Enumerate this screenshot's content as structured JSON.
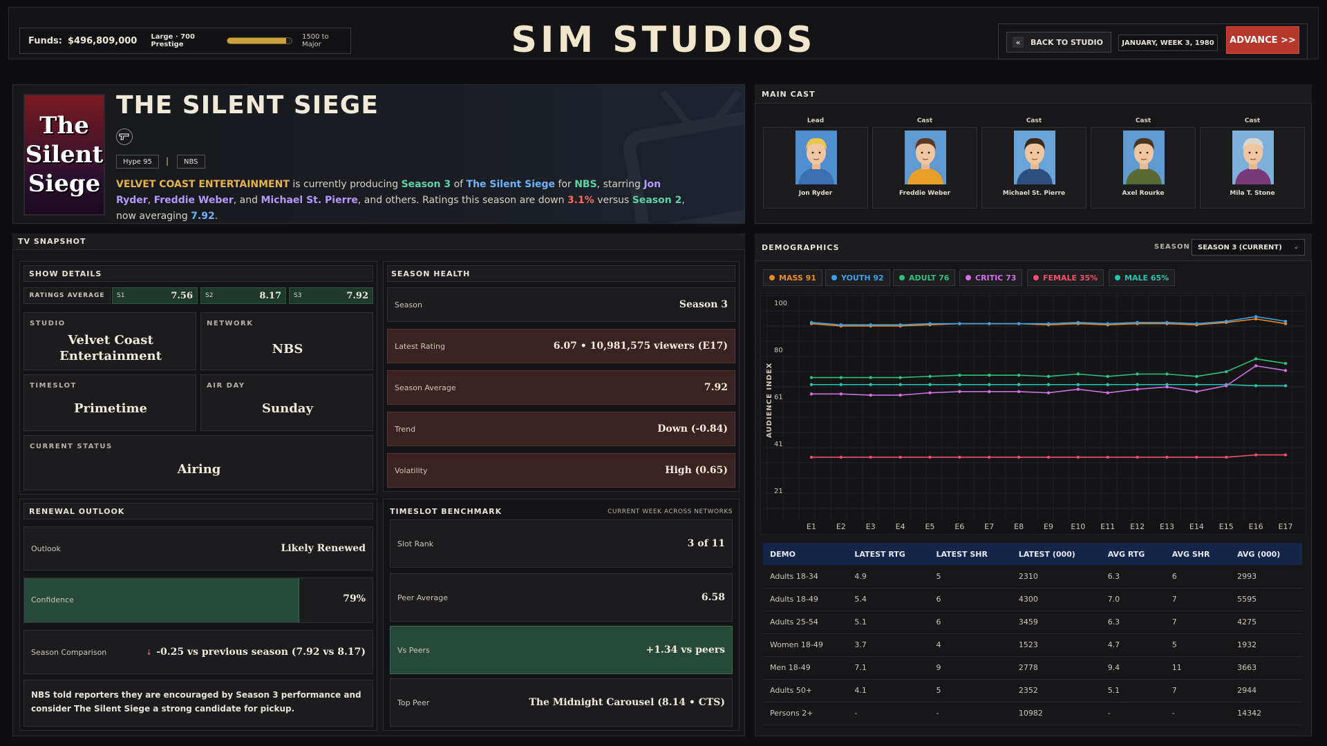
{
  "topbar": {
    "funds_label": "Funds:",
    "funds_value": "$496,809,000",
    "studio_tier": "Large · 700 Prestige",
    "prestige_progress": 0.92,
    "next_tier": "1500 to Major",
    "game_title": "SIM STUDIOS",
    "back_label": "BACK TO STUDIO",
    "back_icon": "«",
    "date": "JANUARY, WEEK 3, 1980",
    "advance_label": "ADVANCE >>"
  },
  "show": {
    "poster_text": [
      "The",
      "Silent",
      "Siege"
    ],
    "title": "THE SILENT SIEGE",
    "genre_icon": "gun-icon",
    "tags": [
      "Hype 95",
      "NBS"
    ],
    "tag_sep": "|",
    "summary": {
      "studio": "VELVET COAST ENTERTAINMENT",
      "t1": " is currently producing ",
      "season": "Season 3",
      "t2": " of ",
      "title": "The Silent Siege",
      "t3": " for ",
      "network": "NBS",
      "t4": ", starring ",
      "star1": "Jon Ryder",
      "t5": ", ",
      "star2": "Freddie Weber",
      "t6": ", and ",
      "star3": "Michael St. Pierre",
      "t7": ", and others. Ratings this season are down ",
      "pct": "3.1%",
      "t8": " versus ",
      "prev": "Season 2",
      "t9": ", now averaging ",
      "avg": "7.92",
      "t10": "."
    }
  },
  "cast": {
    "title": "MAIN CAST",
    "members": [
      {
        "role": "Lead",
        "name": "Jon Ryder",
        "hair": "#e8c74a",
        "shirt": "#3a6fb0",
        "bg": "#4f8fcf"
      },
      {
        "role": "Cast",
        "name": "Freddie Weber",
        "hair": "#5a3a22",
        "shirt": "#e9a02a",
        "bg": "#5f9ad0"
      },
      {
        "role": "Cast",
        "name": "Michael St. Pierre",
        "hair": "#3a2a1e",
        "shirt": "#2c4f80",
        "bg": "#6aa4d6"
      },
      {
        "role": "Cast",
        "name": "Axel Rourke",
        "hair": "#4a3422",
        "shirt": "#5b6a35",
        "bg": "#5f9ad0"
      },
      {
        "role": "Cast",
        "name": "Mila T. Stone",
        "hair": "#d9d6d0",
        "shirt": "#7a3a7a",
        "bg": "#7fb0dc"
      }
    ]
  },
  "snapshot": {
    "title": "TV SNAPSHOT",
    "details": {
      "title": "SHOW DETAILS",
      "ratings_label": "RATINGS AVERAGE",
      "seasons": [
        {
          "label": "S1",
          "value": "7.56"
        },
        {
          "label": "S2",
          "value": "8.17"
        },
        {
          "label": "S3",
          "value": "7.92"
        }
      ],
      "studio_label": "STUDIO",
      "studio": "Velvet Coast Entertainment",
      "network_label": "NETWORK",
      "network": "NBS",
      "timeslot_label": "TIMESLOT",
      "timeslot": "Primetime",
      "airday_label": "AIR DAY",
      "airday": "Sunday",
      "status_label": "CURRENT STATUS",
      "status": "Airing"
    },
    "health": {
      "title": "SEASON HEALTH",
      "rows": [
        {
          "label": "Season",
          "value": "Season 3"
        },
        {
          "label": "Latest Rating",
          "value": "6.07 • 10,981,575 viewers (E17)"
        },
        {
          "label": "Season Average",
          "value": "7.92"
        },
        {
          "label": "Trend",
          "value": "Down (-0.84)"
        },
        {
          "label": "Volatility",
          "value": "High (0.65)"
        }
      ]
    },
    "renewal": {
      "title": "RENEWAL OUTLOOK",
      "outlook_label": "Outlook",
      "outlook": "Likely Renewed",
      "confidence_label": "Confidence",
      "confidence": "79%",
      "confidence_fraction": 0.79,
      "comparison_label": "Season Comparison",
      "comparison_arrow": "↓",
      "comparison": "-0.25 vs previous season (7.92 vs 8.17)",
      "note": "NBS told reporters they are encouraged by Season 3 performance and consider The Silent Siege a strong candidate for pickup."
    },
    "benchmark": {
      "title": "TIMESLOT BENCHMARK",
      "subtitle": "CURRENT WEEK ACROSS NETWORKS",
      "rows": [
        {
          "label": "Slot Rank",
          "value": "3 of 11"
        },
        {
          "label": "Peer Average",
          "value": "6.58"
        },
        {
          "label": "Vs Peers",
          "value": "+1.34 vs peers"
        },
        {
          "label": "Top Peer",
          "value": "The Midnight Carousel (8.14 • CTS)"
        }
      ]
    }
  },
  "demographics": {
    "title": "DEMOGRAPHICS",
    "season_label": "SEASON",
    "season_select": "SEASON 3 (CURRENT)",
    "chips": [
      {
        "label": "MASS 91",
        "color": "#f08a24"
      },
      {
        "label": "YOUTH 92",
        "color": "#3aa3e8"
      },
      {
        "label": "ADULT 76",
        "color": "#2ec27e"
      },
      {
        "label": "CRITIC 73",
        "color": "#d36ee8"
      },
      {
        "label": "FEMALE 35%",
        "color": "#f0506e"
      },
      {
        "label": "MALE 65%",
        "color": "#26c6b0"
      }
    ],
    "table": {
      "headers": [
        "DEMO",
        "LATEST RTG",
        "LATEST SHR",
        "LATEST (000)",
        "AVG RTG",
        "AVG SHR",
        "AVG (000)"
      ],
      "rows": [
        [
          "Adults 18-34",
          "4.9",
          "5",
          "2310",
          "6.3",
          "6",
          "2993"
        ],
        [
          "Adults 18-49",
          "5.4",
          "6",
          "4300",
          "7.0",
          "7",
          "5595"
        ],
        [
          "Adults 25-54",
          "5.1",
          "6",
          "3459",
          "6.3",
          "7",
          "4275"
        ],
        [
          "Women 18-49",
          "3.7",
          "4",
          "1523",
          "4.7",
          "5",
          "1932"
        ],
        [
          "Men 18-49",
          "7.1",
          "9",
          "2778",
          "9.4",
          "11",
          "3663"
        ],
        [
          "Adults 50+",
          "4.1",
          "5",
          "2352",
          "5.1",
          "7",
          "2944"
        ],
        [
          "Persons 2+",
          "-",
          "-",
          "10982",
          "-",
          "-",
          "14342"
        ]
      ]
    }
  },
  "chart_data": {
    "type": "line",
    "ylabel": "AUDIENCE INDEX",
    "ylim": [
      0,
      100
    ],
    "yticks": [
      100,
      80,
      61,
      41,
      21
    ],
    "x": [
      "E1",
      "E2",
      "E3",
      "E4",
      "E5",
      "E6",
      "E7",
      "E8",
      "E9",
      "E10",
      "E11",
      "E12",
      "E13",
      "E14",
      "E15",
      "E16",
      "E17"
    ],
    "grid": true,
    "series": [
      {
        "color": "#f08a24",
        "values": [
          91,
          90,
          90,
          90,
          90.5,
          91,
          91,
          91,
          90.5,
          91,
          90.5,
          91,
          91,
          90.5,
          91.5,
          93,
          91
        ]
      },
      {
        "color": "#3aa3e8",
        "values": [
          91.5,
          90.5,
          90.5,
          90.5,
          91,
          91,
          91,
          91,
          91,
          91.5,
          91,
          91.5,
          91.5,
          91,
          92,
          94,
          92
        ]
      },
      {
        "color": "#2ec27e",
        "values": [
          68,
          68,
          68,
          68,
          68.5,
          69,
          69,
          69,
          68.5,
          69.5,
          68.5,
          69.5,
          69.5,
          68.5,
          70.5,
          76,
          74
        ]
      },
      {
        "color": "#26c6b0",
        "values": [
          65,
          65,
          65,
          65,
          65,
          65,
          65,
          65,
          65,
          65,
          65,
          65,
          65,
          65,
          65,
          64.5,
          64.5
        ]
      },
      {
        "color": "#d36ee8",
        "values": [
          61,
          61,
          60.5,
          60.5,
          61.5,
          62,
          62,
          62,
          61.5,
          63,
          61.5,
          63,
          64,
          62,
          64.5,
          73,
          71
        ]
      },
      {
        "color": "#f0506e",
        "values": [
          34,
          34,
          34,
          34,
          34,
          34,
          34,
          34,
          34,
          34,
          34,
          34,
          34,
          34,
          34,
          35,
          35
        ]
      }
    ]
  }
}
